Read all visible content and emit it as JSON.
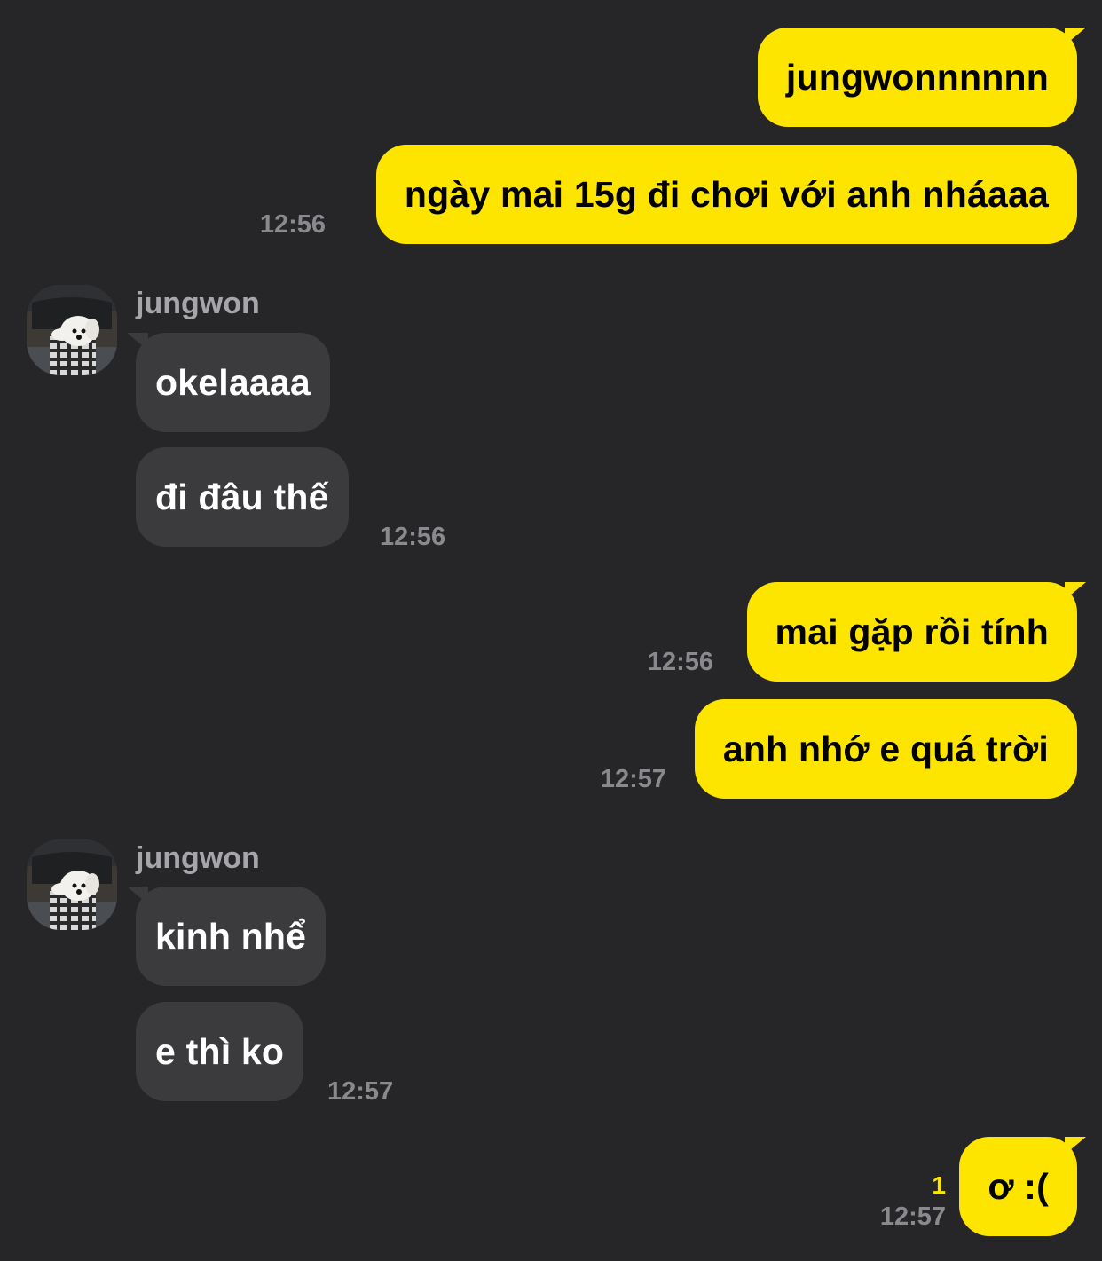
{
  "contact": {
    "name": "jungwon",
    "avatar_icon": "dog-photo-avatar-icon"
  },
  "colors": {
    "background": "#262628",
    "outgoing_bubble": "#FEE500",
    "incoming_bubble": "#3B3B3E",
    "timestamp": "#8A8A8E",
    "unread_badge": "#FEE500"
  },
  "messages": [
    {
      "side": "out",
      "text": "jungwonnnnnn",
      "time": ""
    },
    {
      "side": "out",
      "text": "ngày mai 15g đi chơi với anh nháaaa",
      "time": "12:56"
    },
    {
      "side": "in",
      "text": "okelaaaa",
      "time": ""
    },
    {
      "side": "in",
      "text": "đi đâu thế",
      "time": "12:56"
    },
    {
      "side": "out",
      "text": "mai gặp rồi tính",
      "time": "12:56"
    },
    {
      "side": "out",
      "text": "anh nhớ e quá trời",
      "time": "12:57"
    },
    {
      "side": "in",
      "text": "kinh nhể",
      "time": ""
    },
    {
      "side": "in",
      "text": "e thì ko",
      "time": "12:57"
    },
    {
      "side": "out",
      "text": "ơ :(",
      "time": "12:57",
      "unread": "1"
    }
  ]
}
